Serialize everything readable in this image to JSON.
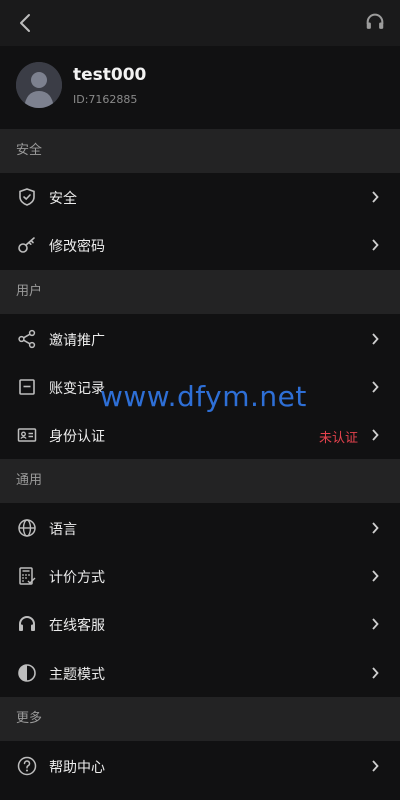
{
  "header": {
    "back_icon": "chevron-left-icon",
    "support_icon": "headset-icon"
  },
  "profile": {
    "username": "test000",
    "user_id": "ID:7162885",
    "avatar_icon": "avatar"
  },
  "sections": [
    {
      "title": "安全",
      "items": [
        {
          "label": "安全",
          "icon": "shield-check-icon"
        },
        {
          "label": "修改密码",
          "icon": "key-icon"
        }
      ]
    },
    {
      "title": "用户",
      "items": [
        {
          "label": "邀请推广",
          "icon": "share-icon"
        },
        {
          "label": "账变记录",
          "icon": "record-icon"
        },
        {
          "label": "身份认证",
          "icon": "id-card-icon",
          "status": "未认证"
        }
      ]
    },
    {
      "title": "通用",
      "items": [
        {
          "label": "语言",
          "icon": "globe-icon"
        },
        {
          "label": "计价方式",
          "icon": "calculator-icon"
        },
        {
          "label": "在线客服",
          "icon": "headset-icon"
        },
        {
          "label": "主题模式",
          "icon": "half-circle-icon"
        }
      ]
    },
    {
      "title": "更多",
      "items": [
        {
          "label": "帮助中心",
          "icon": "question-circle-icon"
        }
      ]
    }
  ],
  "watermark": "www.dfym.net",
  "colors": {
    "background": "#111112",
    "section_header": "#232324",
    "status_warning": "#e5424d",
    "watermark": "#2e6fd6"
  }
}
